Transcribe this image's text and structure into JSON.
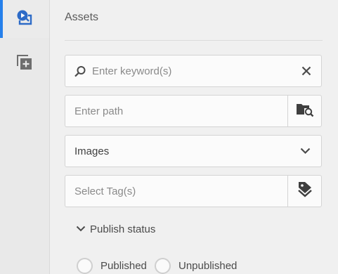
{
  "rail": {
    "items": [
      {
        "icon": "asset-finder-icon",
        "active": true
      },
      {
        "icon": "add-component-icon",
        "active": false
      }
    ],
    "accent": "#2680eb"
  },
  "panel": {
    "title": "Assets",
    "search": {
      "placeholder": "Enter keyword(s)",
      "clear_icon": "close-icon",
      "search_icon": "search-icon"
    },
    "path": {
      "placeholder": "Enter path",
      "browse_icon": "folder-search-icon"
    },
    "type_select": {
      "value": "Images",
      "chevron_icon": "chevron-down-icon"
    },
    "tags": {
      "placeholder": "Select Tag(s)",
      "picker_icon": "tag-icon"
    },
    "publish_status": {
      "label": "Publish status",
      "options": [
        {
          "label": "Published",
          "checked": false
        },
        {
          "label": "Unpublished",
          "checked": false
        }
      ]
    }
  }
}
